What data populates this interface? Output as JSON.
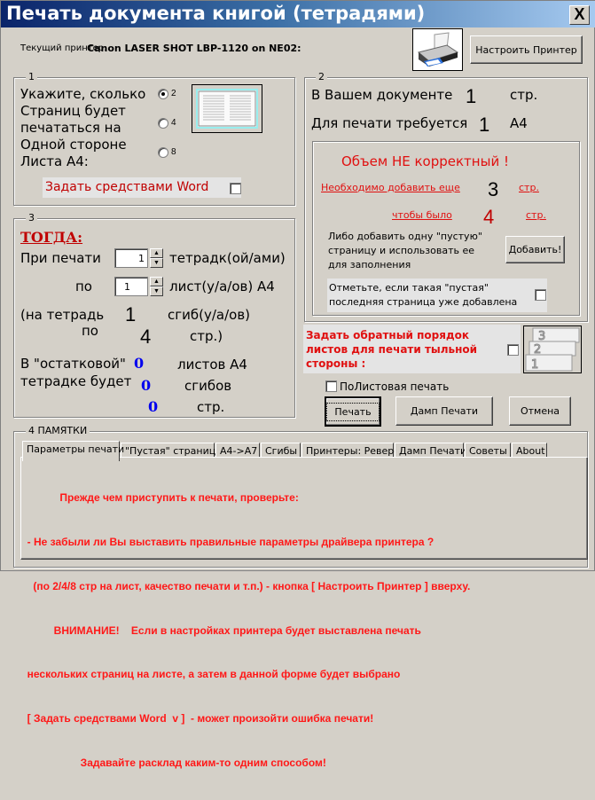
{
  "window": {
    "title": "Печать документа книгой (тетрадями)",
    "close_label": "X"
  },
  "printer": {
    "label": "Текущий принтер:",
    "name": "Canon LASER SHOT LBP-1120 on NE02:",
    "setup_button": "Настроить Принтер"
  },
  "group1": {
    "legend": "1",
    "prompt_lines": [
      "Укажите, сколько",
      "Страниц будет",
      "печататься на",
      "Одной стороне",
      "Листа А4:"
    ],
    "options": [
      {
        "label": "2",
        "selected": true
      },
      {
        "label": "4",
        "selected": false
      },
      {
        "label": "8",
        "selected": false
      }
    ],
    "word_checkbox_label": "Задать средствами Word",
    "word_checkbox_checked": false
  },
  "group2": {
    "legend": "2",
    "doc_pages_label": "В Вашем документе",
    "doc_pages_value": "1",
    "doc_pages_unit": "стр.",
    "required_label": "Для печати требуется",
    "required_value": "1",
    "required_unit": "А4",
    "warning": "Объем НЕ корректный !",
    "need_add_label": "Необходимо добавить еще",
    "need_add_value": "3",
    "need_add_unit": "стр.",
    "to_be_label": "чтобы было",
    "to_be_value": "4",
    "to_be_unit": "стр.",
    "alt_lines": [
      "Либо добавить одну \"пустую\"",
      "страницу и использовать ее",
      "для заполнения"
    ],
    "add_button": "Добавить!",
    "blank_added_lines": [
      "Отметьте, если такая \"пустая\"",
      "последняя страница уже добавлена"
    ],
    "blank_added_checked": false
  },
  "group3": {
    "legend": "3",
    "heading": "ТОГДА:",
    "when_printing_label": "При печати",
    "notebooks_value": "1",
    "notebooks_unit": "тетрадк(ой/ами)",
    "by_label": "по",
    "sheets_value": "1",
    "sheets_unit": "лист(у/а/ов) А4",
    "per_notebook_label": "(на тетрадь",
    "folds_value": "1",
    "folds_unit": "сгиб(у/а/ов)",
    "by2_label": "по",
    "pages_value": "4",
    "pages_unit": "стр.)",
    "remainder_label_1": "В \"остатковой\"",
    "remainder_label_2": "тетрадке будет",
    "rem_sheets_value": "0",
    "rem_sheets_unit": "листов А4",
    "rem_folds_value": "0",
    "rem_folds_unit": "сгибов",
    "rem_pages_value": "0",
    "rem_pages_unit": "стр."
  },
  "reverse": {
    "label_lines": [
      "Задать обратный порядок",
      "листов для печати тыльной",
      "стороны :"
    ],
    "checked": false
  },
  "sheet_print": {
    "label": "ПоЛистовая печать",
    "checked": false
  },
  "actions": {
    "print": "Печать",
    "dump": "Дамп Печати",
    "cancel": "Отмена"
  },
  "memo": {
    "legend": "4 ПАМЯТКИ",
    "tabs": [
      {
        "label": "Параметры печати",
        "active": true
      },
      {
        "label": "\"Пустая\" страница",
        "active": false
      },
      {
        "label": "А4->А7",
        "active": false
      },
      {
        "label": "Сгибы",
        "active": false
      },
      {
        "label": "Принтеры: Реверс",
        "active": false
      },
      {
        "label": "Дамп Печати",
        "active": false
      },
      {
        "label": "Советы",
        "active": false
      },
      {
        "label": "About",
        "active": false
      }
    ],
    "lines": [
      "             Прежде чем приступить к печати, проверьте:",
      "  - Не забыли ли Вы выставить правильные параметры драйвера принтера ?",
      "    (по 2/4/8 стр на лист, качество печати и т.п.) - кнопка [ Настроить Принтер ] вверху.",
      "           ВНИМАНИЕ!    Если в настройках принтера будет выставлена печать",
      "  нескольких страниц на листе, а затем в данной форме будет выбрано",
      "  [ Задать средствами Word  v ]  - может произойти ошибка печати!",
      "                    Задавайте расклад каким-то одним способом!"
    ]
  }
}
